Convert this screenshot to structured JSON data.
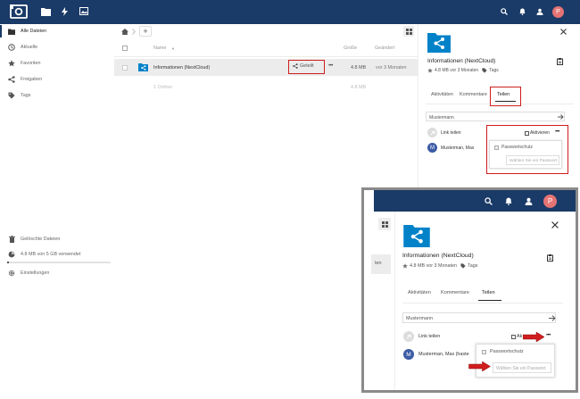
{
  "header": {
    "avatar_letter": "P",
    "icons": [
      "logo-icon",
      "files-icon",
      "activity-icon",
      "gallery-icon",
      "search-icon",
      "notifications-icon",
      "contacts-icon"
    ]
  },
  "sidebar": {
    "items": [
      {
        "label": "Alle Dateien",
        "icon": "folder-icon",
        "active": true
      },
      {
        "label": "Aktuelle",
        "icon": "clock-icon"
      },
      {
        "label": "Favoriten",
        "icon": "star-icon"
      },
      {
        "label": "Freigaben",
        "icon": "share-icon"
      },
      {
        "label": "Tags",
        "icon": "tag-icon"
      }
    ],
    "deleted_label": "Gelöschte Dateien",
    "quota_label": "4.8 MB von 5 GB verwendet",
    "settings_label": "Einstellungen"
  },
  "files": {
    "add_label": "+",
    "columns": {
      "name": "Name",
      "size": "Größe",
      "modified": "Geändert"
    },
    "rows": [
      {
        "name": "Informationen (NextCloud)",
        "share_label": "Geteilt",
        "more": "•••",
        "size": "4.8 MB",
        "modified": "vor 3 Monaten"
      }
    ],
    "summary": {
      "count": "1 Ordner",
      "size": "4.8 MB"
    }
  },
  "details": {
    "title": "Informationen (NextCloud)",
    "meta_size": "4.8 MB vor 3 Monaten",
    "meta_tags": "Tags",
    "tabs": [
      "Aktivitäten",
      "Kommentare",
      "Teilen"
    ],
    "active_tab": "Teilen",
    "share_input_value": "Mustermann",
    "link_label": "Link teilen",
    "activate_label": "Aktivieren",
    "more": "•••",
    "password_label": "Passwortschutz",
    "password_placeholder": "Wählen Sie ein Passwort",
    "user_initial": "M",
    "user_name": "Musterman, Max",
    "user_name_inset": "Musterman, Max (haste"
  },
  "inset": {
    "left_fragment": "ten",
    "activate_fragment": "Ak"
  },
  "colors": {
    "header": "#1a3a67",
    "accent": "#0082c9",
    "annotation": "#d01d1d",
    "avatar": "#e57373"
  }
}
